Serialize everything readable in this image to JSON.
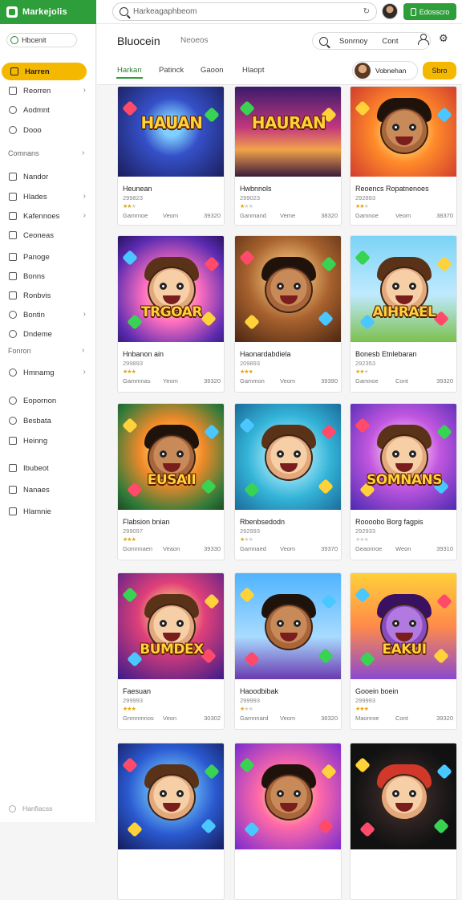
{
  "app": {
    "name": "Markejolis",
    "url": "Harkeagaphbeom",
    "action_label": "Edosscro"
  },
  "sidebar": {
    "tag": "Hbcenit",
    "items": [
      {
        "label": "Harren",
        "icon": "search-icon",
        "chevron": false,
        "active": true
      },
      {
        "label": "Reorren",
        "icon": "document-icon",
        "chevron": true
      },
      {
        "label": "Aodmnt",
        "icon": "clock-icon",
        "chevron": false
      },
      {
        "label": "Dooo",
        "icon": "circle-icon",
        "chevron": false
      }
    ],
    "section1": "Comnans",
    "items2": [
      {
        "label": "Nandor",
        "icon": "book-icon",
        "chevron": false
      },
      {
        "label": "Hlades",
        "icon": "grid-icon",
        "chevron": true
      },
      {
        "label": "Kafennoes",
        "icon": "tag-icon",
        "chevron": true
      },
      {
        "label": "Ceoneas",
        "icon": "file-icon",
        "chevron": false
      },
      {
        "label": "Panoge",
        "icon": "folder-icon",
        "chevron": false
      },
      {
        "label": "Bonns",
        "icon": "inbox-icon",
        "chevron": false
      },
      {
        "label": "Ronbvis",
        "icon": "pen-icon",
        "chevron": false
      },
      {
        "label": "Bontin",
        "icon": "circle-icon",
        "chevron": true
      },
      {
        "label": "Dndeme",
        "icon": "clock-icon",
        "chevron": false
      }
    ],
    "section2": "Fonron",
    "items3": [
      {
        "label": "Hmnamg",
        "icon": "settings-icon",
        "chevron": true
      },
      {
        "label": "Eopornon",
        "icon": "user-icon",
        "chevron": false
      },
      {
        "label": "Besbata",
        "icon": "clock-icon",
        "chevron": false
      },
      {
        "label": "Heinng",
        "icon": "shield-icon",
        "chevron": false
      },
      {
        "label": "Ibubeot",
        "icon": "file-icon",
        "chevron": false
      },
      {
        "label": "Nanaes",
        "icon": "grid-icon",
        "chevron": false
      },
      {
        "label": "Hlamnie",
        "icon": "list-icon",
        "chevron": false
      }
    ],
    "footer": "Hanfiacss"
  },
  "header": {
    "title": "Bluocein",
    "subtitle": "Neoeos",
    "sort_label": "Sonrnoy",
    "cost_label": "Cont",
    "tabs": [
      "Harkan",
      "Patinck",
      "Gaoon",
      "Hlaopt"
    ],
    "creator": "Vobnehan",
    "cta": "Sbro"
  },
  "cards": [
    {
      "name": "Heunean",
      "count": "299823",
      "rating": 2,
      "f1": "Gamrnoe",
      "f2": "Veom",
      "f3": "39320",
      "title": "HAUAN",
      "palette": "blue",
      "hero": "none"
    },
    {
      "name": "Hwbnnols",
      "count": "299023",
      "rating": 1,
      "f1": "Ganmand",
      "f2": "Veme",
      "f3": "38320",
      "title": "HAURAN",
      "palette": "city",
      "hero": "none"
    },
    {
      "name": "Reoencs Ropatnenoes",
      "count": "292893",
      "rating": 2,
      "f1": "Gamnoe",
      "f2": "Veom",
      "f3": "38370",
      "title": "",
      "palette": "orange",
      "hero": "dark"
    },
    {
      "name": "Hnbanon ain",
      "count": "299893",
      "rating": 4,
      "f1": "Gammnas",
      "f2": "Yeom",
      "f3": "39320",
      "title": "TRGOAR",
      "palette": "purple",
      "hero": "light"
    },
    {
      "name": "Haonardabdiela",
      "count": "209893",
      "rating": 3,
      "f1": "Gammon",
      "f2": "Veom",
      "f3": "39390",
      "title": "",
      "palette": "brown",
      "hero": "dark"
    },
    {
      "name": "Bonesb Etnlebaran",
      "count": "292353",
      "rating": 2,
      "f1": "Gamnoe",
      "f2": "Cont",
      "f3": "39320",
      "title": "AIHRAEL",
      "palette": "sky",
      "hero": "light"
    },
    {
      "name": "Flabsion bnian",
      "count": "299097",
      "rating": 3,
      "f1": "Gomnnaen",
      "f2": "Veaon",
      "f3": "39330",
      "title": "EUSAII",
      "palette": "green",
      "hero": "dark"
    },
    {
      "name": "Rbenbsedodn",
      "count": "292993",
      "rating": 1,
      "f1": "Gamnaed",
      "f2": "Veom",
      "f3": "39370",
      "title": "",
      "palette": "teal",
      "hero": "light"
    },
    {
      "name": "Roooobo Borg fagpis",
      "count": "292933",
      "rating": 0,
      "f1": "Geaonroe",
      "f2": "Weon",
      "f3": "39310",
      "title": "SOMNANS",
      "palette": "violet",
      "hero": "light"
    },
    {
      "name": "Faesuan",
      "count": "299993",
      "rating": 3,
      "f1": "Gnmnmnos",
      "f2": "Veon",
      "f3": "30302",
      "title": "BUMDEX",
      "palette": "magenta",
      "hero": "light"
    },
    {
      "name": "Haoodbibak",
      "count": "299993",
      "rating": 1,
      "f1": "Gamnnard",
      "f2": "Veom",
      "f3": "38320",
      "title": "",
      "palette": "azure",
      "hero": "dark"
    },
    {
      "name": "Gooein boein",
      "count": "299993",
      "rating": 3,
      "f1": "Maonroe",
      "f2": "Cont",
      "f3": "39320",
      "title": "EAKUI",
      "palette": "sunset",
      "hero": "purple"
    },
    {
      "name": "",
      "count": "",
      "rating": 0,
      "f1": "",
      "f2": "",
      "f3": "",
      "title": "",
      "palette": "deepblue",
      "hero": "light"
    },
    {
      "name": "",
      "count": "",
      "rating": 0,
      "f1": "",
      "f2": "",
      "f3": "",
      "title": "",
      "palette": "pinkburst",
      "hero": "dark"
    },
    {
      "name": "",
      "count": "",
      "rating": 0,
      "f1": "",
      "f2": "",
      "f3": "",
      "title": "",
      "palette": "night",
      "hero": "red"
    }
  ],
  "colors": {
    "brand_green": "#2e9e3a",
    "accent_yellow": "#f5b800",
    "star": "#e6a400"
  }
}
